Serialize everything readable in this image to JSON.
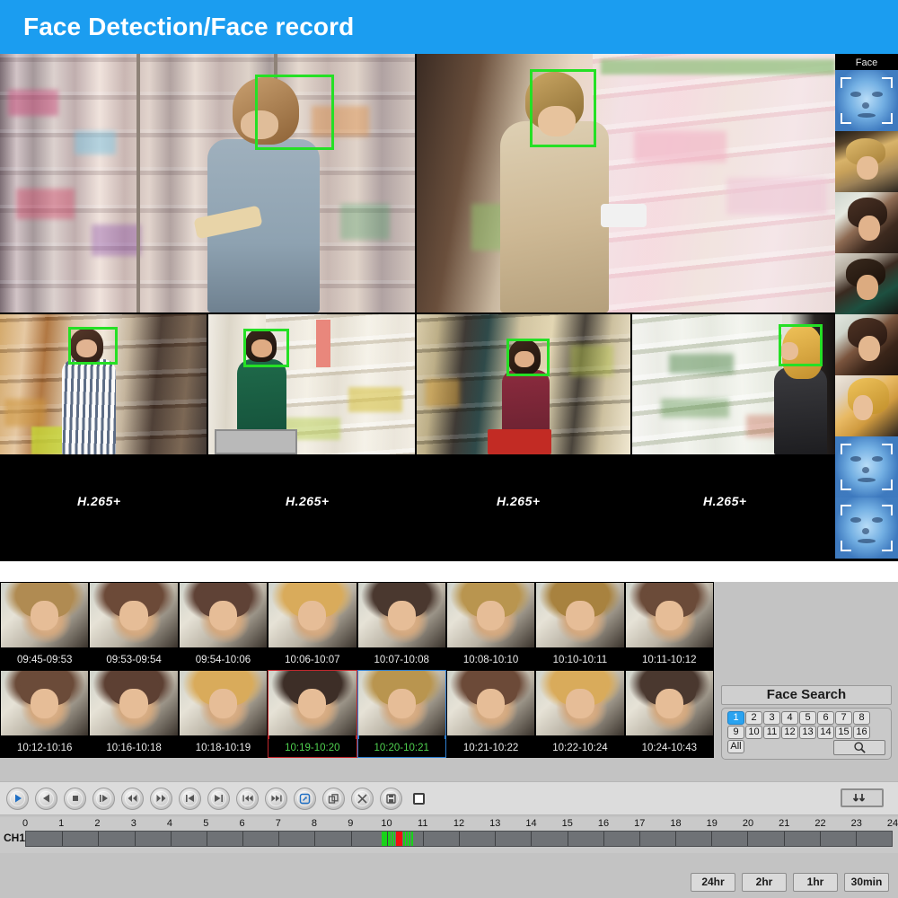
{
  "header": {
    "title": "Face Detection/Face record"
  },
  "video_wall": {
    "codec_label": "H.265+",
    "panels": [
      {
        "id": "cam-1",
        "codec": "H.265+",
        "detection": true
      },
      {
        "id": "cam-2",
        "codec": "H.265+",
        "detection": true
      },
      {
        "id": "cam-3",
        "codec": "H.265+",
        "detection": true
      },
      {
        "id": "cam-4",
        "codec": "H.265+",
        "detection": true
      },
      {
        "id": "cam-5",
        "codec": "H.265+",
        "detection": true
      },
      {
        "id": "cam-6",
        "codec": "H.265+",
        "detection": true
      }
    ],
    "codec_labels": [
      "H.265+",
      "H.265+",
      "H.265+",
      "H.265+"
    ],
    "face_panel": {
      "title": "Face",
      "snapshots": [
        {
          "kind": "scan",
          "tone": "#6ba4d8"
        },
        {
          "kind": "photo",
          "tone": "#c49a63"
        },
        {
          "kind": "photo",
          "tone": "#7a5240"
        },
        {
          "kind": "photo",
          "tone": "#4d3a30"
        },
        {
          "kind": "photo",
          "tone": "#8d6a55"
        },
        {
          "kind": "photo",
          "tone": "#d8a85c"
        },
        {
          "kind": "scan",
          "tone": "#6ba4d8"
        },
        {
          "kind": "scan",
          "tone": "#6ba4d8"
        }
      ]
    }
  },
  "thumbnails": {
    "items": [
      {
        "time": "09:45-09:53",
        "selected": "none",
        "tone": "#b08b52"
      },
      {
        "time": "09:53-09:54",
        "selected": "none",
        "tone": "#6c4a38"
      },
      {
        "time": "09:54-10:06",
        "selected": "none",
        "tone": "#5f4236"
      },
      {
        "time": "10:06-10:07",
        "selected": "none",
        "tone": "#d9ab5b"
      },
      {
        "time": "10:07-10:08",
        "selected": "none",
        "tone": "#4a382f"
      },
      {
        "time": "10:08-10:10",
        "selected": "none",
        "tone": "#b9954f"
      },
      {
        "time": "10:10-10:11",
        "selected": "none",
        "tone": "#a8823f"
      },
      {
        "time": "10:11-10:12",
        "selected": "none",
        "tone": "#6b4b39"
      },
      {
        "time": "10:12-10:16",
        "selected": "none",
        "tone": "#6b4b39"
      },
      {
        "time": "10:16-10:18",
        "selected": "none",
        "tone": "#5d4033"
      },
      {
        "time": "10:18-10:19",
        "selected": "none",
        "tone": "#d9ab5b"
      },
      {
        "time": "10:19-10:20",
        "selected": "red",
        "tone": "#3d2e27"
      },
      {
        "time": "10:20-10:21",
        "selected": "blue",
        "tone": "#b9954f"
      },
      {
        "time": "10:21-10:22",
        "selected": "none",
        "tone": "#6c4a38"
      },
      {
        "time": "10:22-10:24",
        "selected": "none",
        "tone": "#d9ab5b"
      },
      {
        "time": "10:24-10:43",
        "selected": "none",
        "tone": "#4a382f"
      }
    ]
  },
  "face_search": {
    "title": "Face Search",
    "channels": [
      "1",
      "2",
      "3",
      "4",
      "5",
      "6",
      "7",
      "8",
      "9",
      "10",
      "11",
      "12",
      "13",
      "14",
      "15",
      "16"
    ],
    "active_channel": "1",
    "all_label": "All",
    "search_icon": "magnifier-icon"
  },
  "controls": {
    "buttons": [
      {
        "name": "play-button",
        "icon": "play-icon"
      },
      {
        "name": "reverse-play-button",
        "icon": "play-reverse-icon"
      },
      {
        "name": "stop-button",
        "icon": "stop-icon"
      },
      {
        "name": "frame-step-button",
        "icon": "frame-step-icon"
      },
      {
        "name": "rewind-button",
        "icon": "rewind-icon"
      },
      {
        "name": "fast-forward-button",
        "icon": "fast-forward-icon"
      },
      {
        "name": "prev-frame-button",
        "icon": "skip-start-icon"
      },
      {
        "name": "next-frame-button",
        "icon": "skip-end-icon"
      },
      {
        "name": "prev-file-button",
        "icon": "prev-track-icon"
      },
      {
        "name": "next-file-button",
        "icon": "next-track-icon"
      },
      {
        "name": "digital-zoom-button",
        "icon": "zoom-region-icon"
      },
      {
        "name": "clip-button",
        "icon": "clip-icon"
      },
      {
        "name": "cut-button",
        "icon": "scissors-icon"
      },
      {
        "name": "save-button",
        "icon": "floppy-icon"
      }
    ],
    "stop-square": {
      "name": "full-stop-toggle",
      "icon": "square-icon"
    },
    "sync_button": {
      "name": "sync-button",
      "icon": "two-arrows-icon"
    }
  },
  "timeline": {
    "channel_label": "CH1",
    "hours": [
      "0",
      "1",
      "2",
      "3",
      "4",
      "5",
      "6",
      "7",
      "8",
      "9",
      "10",
      "11",
      "12",
      "13",
      "14",
      "15",
      "16",
      "17",
      "18",
      "19",
      "20",
      "21",
      "22",
      "23",
      "24"
    ],
    "range_start": 0,
    "range_end": 24,
    "events": [
      {
        "start": 9.86,
        "end": 10.02,
        "color": "#19d319"
      },
      {
        "start": 10.04,
        "end": 10.1,
        "color": "#19d319"
      },
      {
        "start": 10.13,
        "end": 10.17,
        "color": "#19d319"
      },
      {
        "start": 10.2,
        "end": 10.23,
        "color": "#19d319"
      },
      {
        "start": 10.26,
        "end": 10.42,
        "color": "#f01010"
      },
      {
        "start": 10.46,
        "end": 10.5,
        "color": "#19d319"
      },
      {
        "start": 10.53,
        "end": 10.57,
        "color": "#19d319"
      },
      {
        "start": 10.6,
        "end": 10.64,
        "color": "#19d319"
      },
      {
        "start": 10.67,
        "end": 10.72,
        "color": "#19d319"
      }
    ],
    "recorded_span": {
      "start": 9.86,
      "end": 10.95
    }
  },
  "range_buttons": [
    {
      "label": "24hr"
    },
    {
      "label": "2hr"
    },
    {
      "label": "1hr"
    },
    {
      "label": "30min"
    }
  ],
  "colors": {
    "header_bg": "#1b9df0",
    "panel_bg": "#c3c3c3",
    "detection_box": "#25e025",
    "selected_red": "#c1272d",
    "selected_blue": "#2f7fd0",
    "caption_green": "#4fd14f",
    "timeline_track": "#6f7276",
    "event_green": "#19d319",
    "event_red": "#f01010",
    "active_channel": "#2aa3f0"
  }
}
